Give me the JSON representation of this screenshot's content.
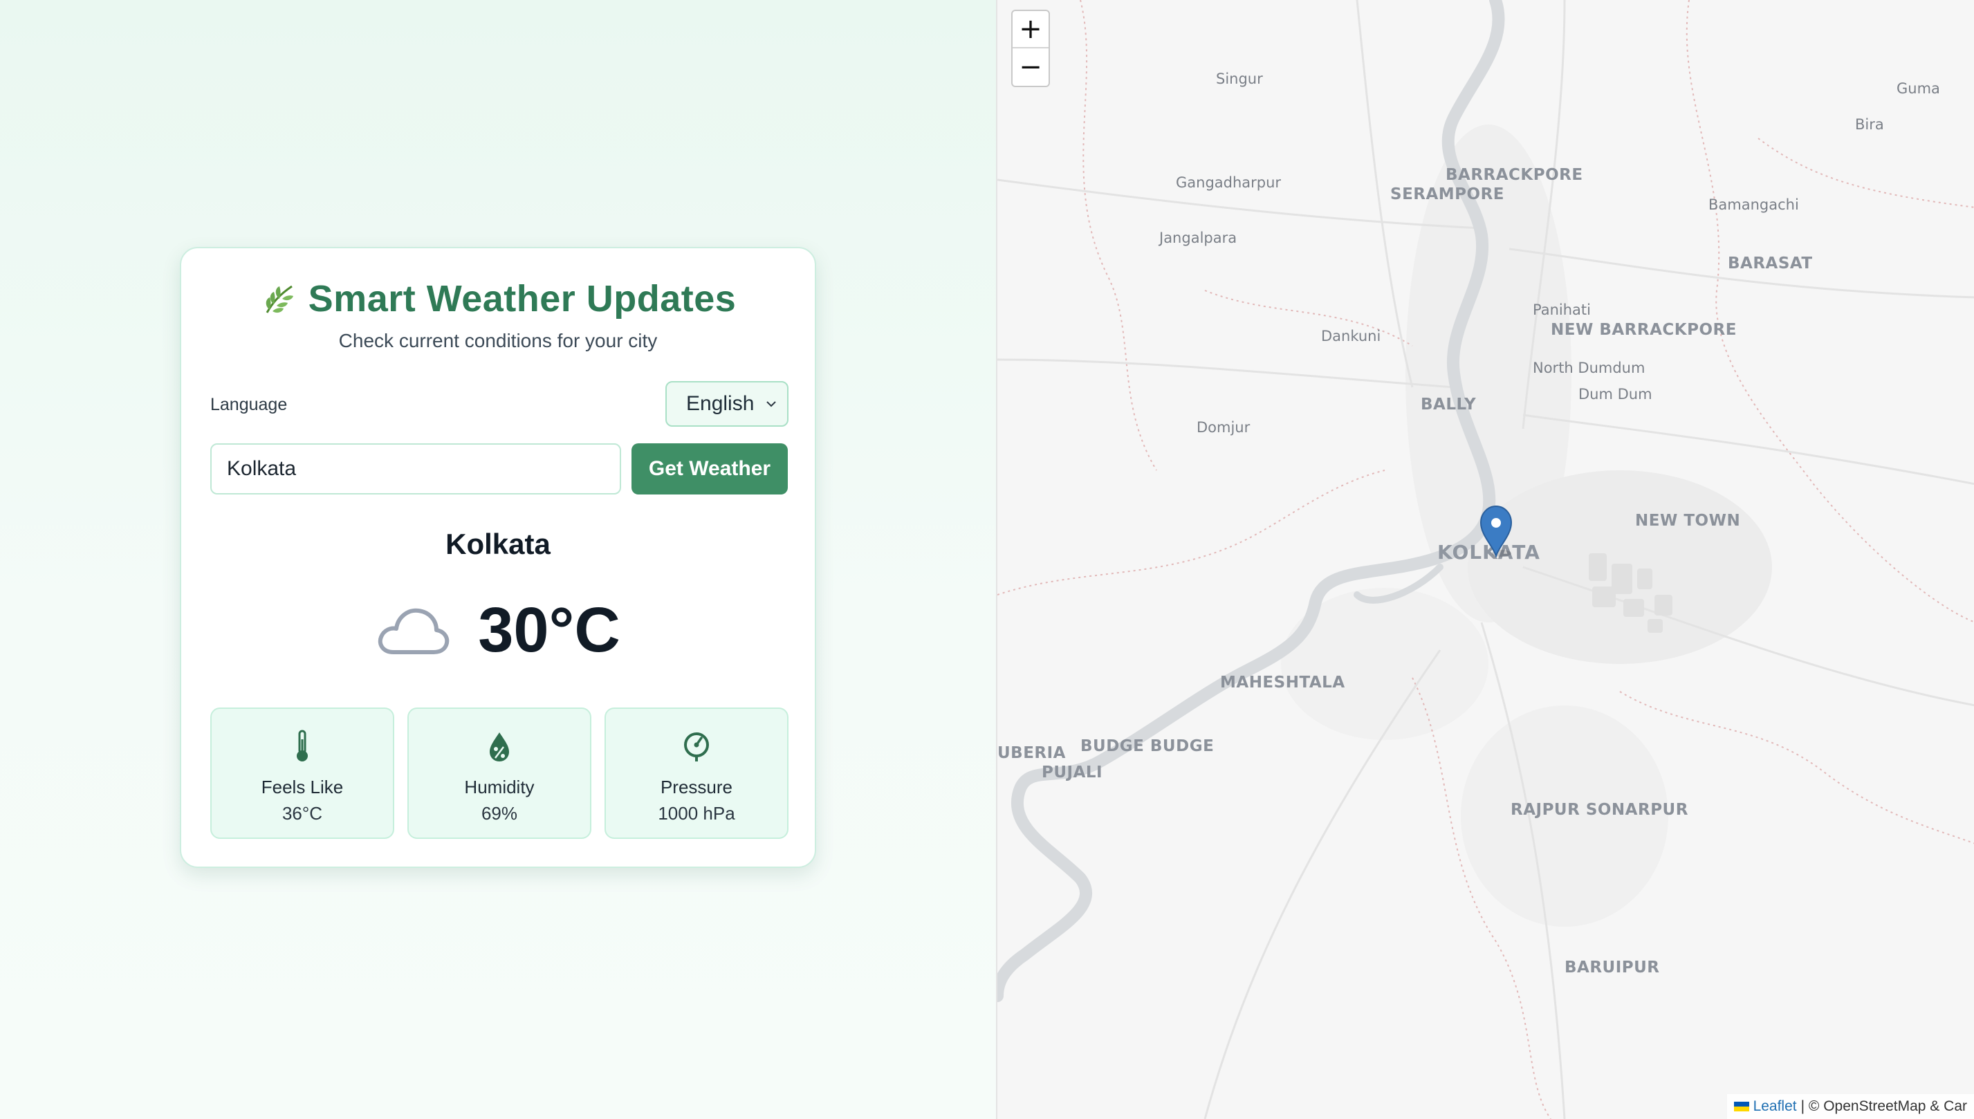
{
  "app": {
    "title": "Smart Weather Updates",
    "subtitle": "Check current conditions for your city"
  },
  "language": {
    "label": "Language",
    "selected": "English"
  },
  "search": {
    "value": "Kolkata",
    "button_label": "Get Weather"
  },
  "weather": {
    "city": "Kolkata",
    "temperature": "30°C",
    "condition_icon": "cloud-icon",
    "details": [
      {
        "label": "Feels Like",
        "value": "36°C",
        "icon": "thermometer-icon"
      },
      {
        "label": "Humidity",
        "value": "69%",
        "icon": "humidity-drop-icon"
      },
      {
        "label": "Pressure",
        "value": "1000 hPa",
        "icon": "pressure-gauge-icon"
      }
    ]
  },
  "map": {
    "zoom_in": "+",
    "zoom_out": "−",
    "labels": {
      "singur": "Singur",
      "gangadharpur": "Gangadharpur",
      "jangalpara": "Jangalpara",
      "barrackpore": "BARRACKPORE",
      "serampore": "SERAMPORE",
      "bamangachi": "Bamangachi",
      "guma": "Guma",
      "bira": "Bira",
      "barasat": "BARASAT",
      "panihati": "Panihati",
      "new_barrackpore": "NEW BARRACKPORE",
      "dankuni": "Dankuni",
      "north_dumdum": "North Dumdum",
      "dum_dum": "Dum Dum",
      "bally": "BALLY",
      "domjur": "Domjur",
      "new_town": "NEW TOWN",
      "kolkata": "KOLKATA",
      "maheshtala": "MAHESHTALA",
      "budge_budge": "BUDGE BUDGE",
      "uberia": "UBERIA",
      "pujali": "PUJALI",
      "rajpur_sonarpur": "RAJPUR SONARPUR",
      "baruipur": "BARUIPUR"
    },
    "attribution_link": "Leaflet",
    "attribution_text": "| © OpenStreetMap & Car"
  },
  "colors": {
    "accent": "#3f8f66",
    "title": "#2f7a56",
    "tile_bg": "#eafaf3",
    "marker": "#3b7cc4"
  }
}
